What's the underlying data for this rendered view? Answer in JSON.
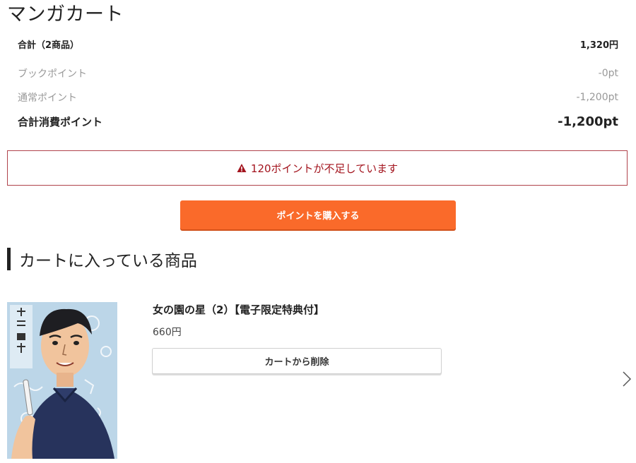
{
  "page": {
    "title": "マンガカート"
  },
  "summary": {
    "total_label": "合計（2商品）",
    "total_value": "1,320円",
    "book_point_label": "ブックポイント",
    "book_point_value": "-0pt",
    "normal_point_label": "通常ポイント",
    "normal_point_value": "-1,200pt",
    "consumed_label": "合計消費ポイント",
    "consumed_value": "-1,200pt"
  },
  "alert": {
    "icon": "warning-icon",
    "message": "120ポイントが不足しています",
    "color": "#a3141e"
  },
  "buy_button": {
    "label": "ポイントを購入する",
    "color": "#fa6a2a"
  },
  "cart_section": {
    "heading": "カートに入っている商品"
  },
  "items": [
    {
      "title": "女の園の星（2）【電子限定特典付】",
      "price": "660円",
      "remove_label": "カートから削除"
    }
  ],
  "navigation": {
    "next_icon": "chevron-right-icon"
  }
}
